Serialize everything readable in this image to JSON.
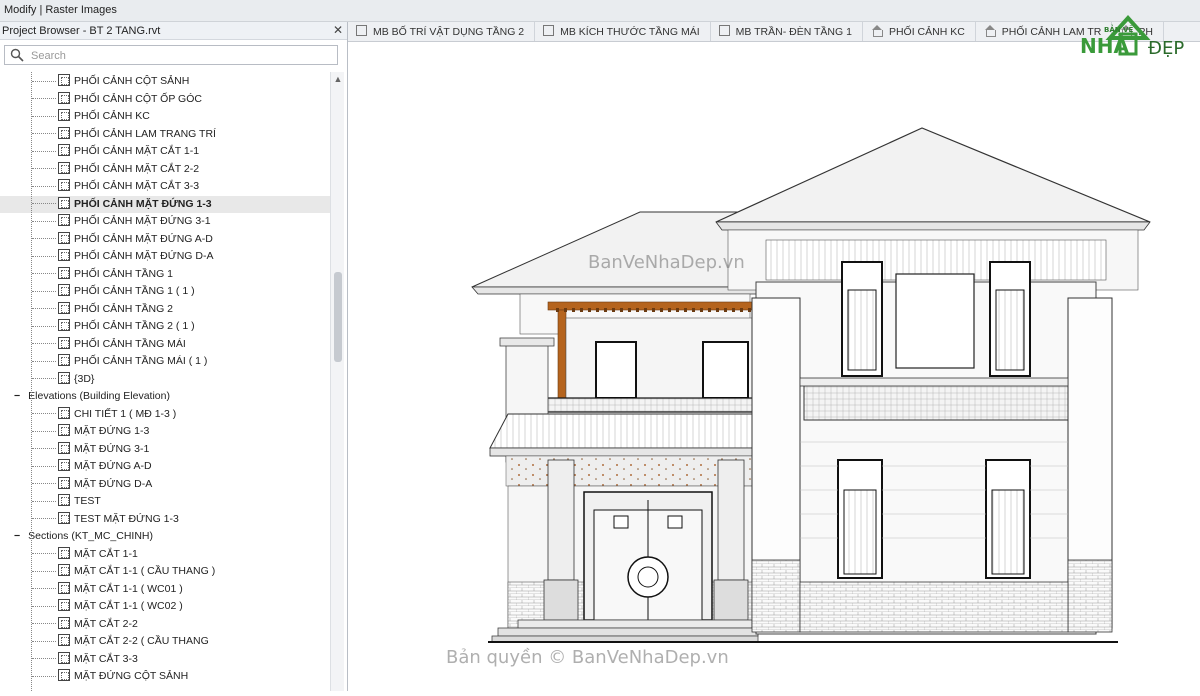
{
  "ribbon": {
    "label": "Modify | Raster Images"
  },
  "browser": {
    "title": "Project Browser - BT 2 TANG.rvt",
    "close_glyph": "✕",
    "search_placeholder": "Search",
    "tree": [
      {
        "label": "PHỐI CẢNH CỘT SẢNH",
        "level": 2
      },
      {
        "label": "PHỐI CẢNH CỘT ỐP GÓC",
        "level": 2
      },
      {
        "label": "PHỐI CẢNH KC",
        "level": 2
      },
      {
        "label": "PHỐI CẢNH LAM TRANG TRÍ",
        "level": 2
      },
      {
        "label": "PHỐI CẢNH MẶT CẮT 1-1",
        "level": 2
      },
      {
        "label": "PHỐI CẢNH MẶT CẮT 2-2",
        "level": 2
      },
      {
        "label": "PHỐI CẢNH MẶT CẮT 3-3",
        "level": 2
      },
      {
        "label": "PHỐI CẢNH MẶT ĐỨNG 1-3",
        "level": 2,
        "selected": true
      },
      {
        "label": "PHỐI CẢNH MẶT ĐỨNG 3-1",
        "level": 2
      },
      {
        "label": "PHỐI CẢNH MẶT ĐỨNG A-D",
        "level": 2
      },
      {
        "label": "PHỐI CẢNH MẶT ĐỨNG D-A",
        "level": 2
      },
      {
        "label": "PHỐI CẢNH TẦNG 1",
        "level": 2
      },
      {
        "label": "PHỐI CẢNH TẦNG 1 ( 1 )",
        "level": 2
      },
      {
        "label": "PHỐI CẢNH TẦNG 2",
        "level": 2
      },
      {
        "label": "PHỐI CẢNH TẦNG 2 ( 1 )",
        "level": 2
      },
      {
        "label": "PHỐI CẢNH TẦNG MÁI",
        "level": 2
      },
      {
        "label": "PHỐI CẢNH TẦNG MÁI ( 1 )",
        "level": 2
      },
      {
        "label": "{3D}",
        "level": 2
      },
      {
        "label": "Elevations (Building Elevation)",
        "level": 1,
        "group": true
      },
      {
        "label": "CHI TIẾT 1 ( MĐ 1-3 )",
        "level": 2
      },
      {
        "label": "MẶT ĐỨNG 1-3",
        "level": 2
      },
      {
        "label": "MẶT ĐỨNG 3-1",
        "level": 2
      },
      {
        "label": "MẶT ĐỨNG A-D",
        "level": 2
      },
      {
        "label": "MẶT ĐỨNG D-A",
        "level": 2
      },
      {
        "label": "TEST",
        "level": 2
      },
      {
        "label": "TEST MẶT ĐỨNG 1-3",
        "level": 2
      },
      {
        "label": "Sections (KT_MC_CHINH)",
        "level": 1,
        "group": true
      },
      {
        "label": "MẶT CẮT 1-1",
        "level": 2
      },
      {
        "label": "MẶT CẮT 1-1 ( CẦU THANG )",
        "level": 2
      },
      {
        "label": "MẶT CẮT 1-1 ( WC01 )",
        "level": 2
      },
      {
        "label": "MẶT CẮT 1-1 ( WC02 )",
        "level": 2
      },
      {
        "label": "MẶT CẮT 2-2",
        "level": 2
      },
      {
        "label": "MẶT CẮT 2-2 ( CẦU THANG",
        "level": 2
      },
      {
        "label": "MẶT CẮT 3-3",
        "level": 2
      },
      {
        "label": "MẶT ĐỨNG CỘT SẢNH",
        "level": 2
      }
    ]
  },
  "tabs": [
    {
      "label": "MB BỐ TRÍ VẬT DỤNG TẦNG 2",
      "icon": "plan-icon"
    },
    {
      "label": "MB KÍCH THƯỚC TẦNG MÁI",
      "icon": "plan-icon"
    },
    {
      "label": "MB TRẦN- ĐÈN TẦNG 1",
      "icon": "ceiling-icon"
    },
    {
      "label": "PHỐI CẢNH KC",
      "icon": "house-icon"
    },
    {
      "label": "PHỐI CẢNH LAM TR",
      "icon": "house-icon"
    },
    {
      "label": "PH",
      "icon": "house-icon"
    }
  ],
  "canvas": {
    "watermark_top": "BanVeNhaDep.vn",
    "watermark_bottom": "Bản quyền © BanVeNhaDep.vn",
    "logo": {
      "line1": "BẢN VẼ",
      "line2": "NHÀ",
      "line3": "ĐẸP"
    }
  },
  "colors": {
    "accent": "#3a9a3a",
    "wood": "#b5641e",
    "window_frame": "#1a1a1a"
  }
}
